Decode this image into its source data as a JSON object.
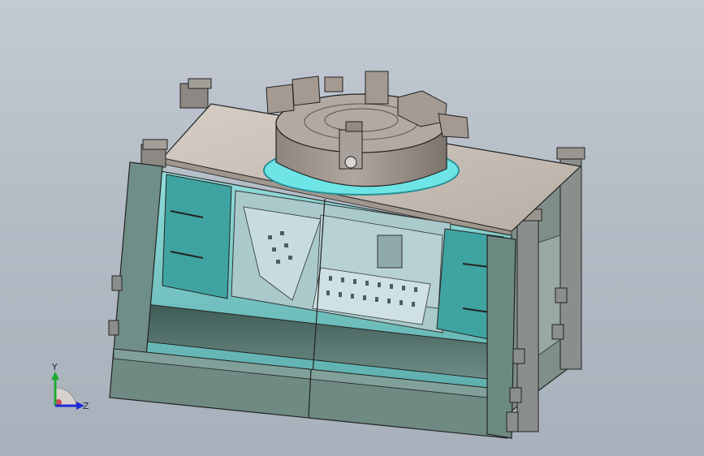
{
  "triad": {
    "y_label": "Y",
    "z_label": "Z",
    "colors": {
      "y": "#1faa2e",
      "z": "#1b2bd6",
      "x": "#c0392b"
    }
  },
  "colors": {
    "background": "#b8c0ca",
    "frame": "#6d8a82",
    "top_plate": "#c8bfb6",
    "glass": "#7fd3d0",
    "chuck": "#a59b93",
    "edge": "#222222"
  }
}
